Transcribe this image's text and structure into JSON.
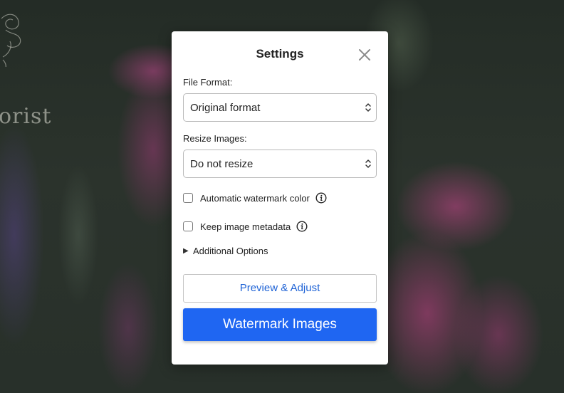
{
  "background": {
    "brand_text": "orist"
  },
  "modal": {
    "title": "Settings",
    "file_format": {
      "label": "File Format:",
      "selected": "Original format"
    },
    "resize_images": {
      "label": "Resize Images:",
      "selected": "Do not resize"
    },
    "options": [
      {
        "label": "Automatic watermark color",
        "checked": false
      },
      {
        "label": "Keep image metadata",
        "checked": false
      }
    ],
    "additional_options": {
      "label": "Additional Options",
      "expanded": false
    },
    "preview_button": "Preview & Adjust",
    "watermark_button": "Watermark Images"
  },
  "colors": {
    "primary": "#1f66f2",
    "link": "#1f63d6"
  }
}
